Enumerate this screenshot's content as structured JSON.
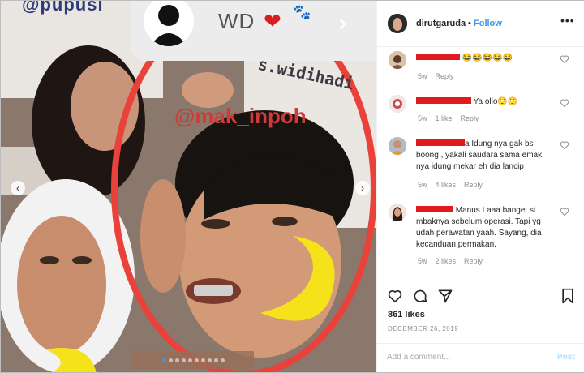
{
  "media": {
    "watermark_top": "@pupusi",
    "watermark_mid": "@mak_inpoh",
    "watermark_side": "s.widihadi",
    "story_label": "WD",
    "story_heart": "❤",
    "story_paws": "🐾",
    "carousel_pages": 10,
    "carousel_active": 1,
    "accent_circle_color": "#e8423b",
    "moon_color": "#f5e21a"
  },
  "header": {
    "username": "dirutgaruda",
    "separator": "•",
    "follow_label": "Follow",
    "more_icon": "more-horizontal-icon"
  },
  "comments": [
    {
      "text": " 😂😂😂😂😂",
      "time": "5w",
      "likes": "",
      "reply": "Reply"
    },
    {
      "text": " Ya ollo🙄🙄",
      "time": "5w",
      "likes": "1 like",
      "reply": "Reply"
    },
    {
      "text": "a Idung nya gak bs boong , yakali saudara sama emak nya idung mekar eh dia lancip",
      "time": "5w",
      "likes": "4 likes",
      "reply": "Reply"
    },
    {
      "text": " Manus Laaa banget si mbaknya sebelum operasi. Tapi yg udah perawatan yaah. Sayang, dia kecanduan permakan.",
      "time": "5w",
      "likes": "2 likes",
      "reply": "Reply"
    }
  ],
  "post": {
    "likes": "861 likes",
    "date": "DECEMBER 26, 2019",
    "add_comment_placeholder": "Add a comment...",
    "post_label": "Post"
  },
  "colors": {
    "link_blue": "#3897f0",
    "redaction": "#e01b1b"
  }
}
